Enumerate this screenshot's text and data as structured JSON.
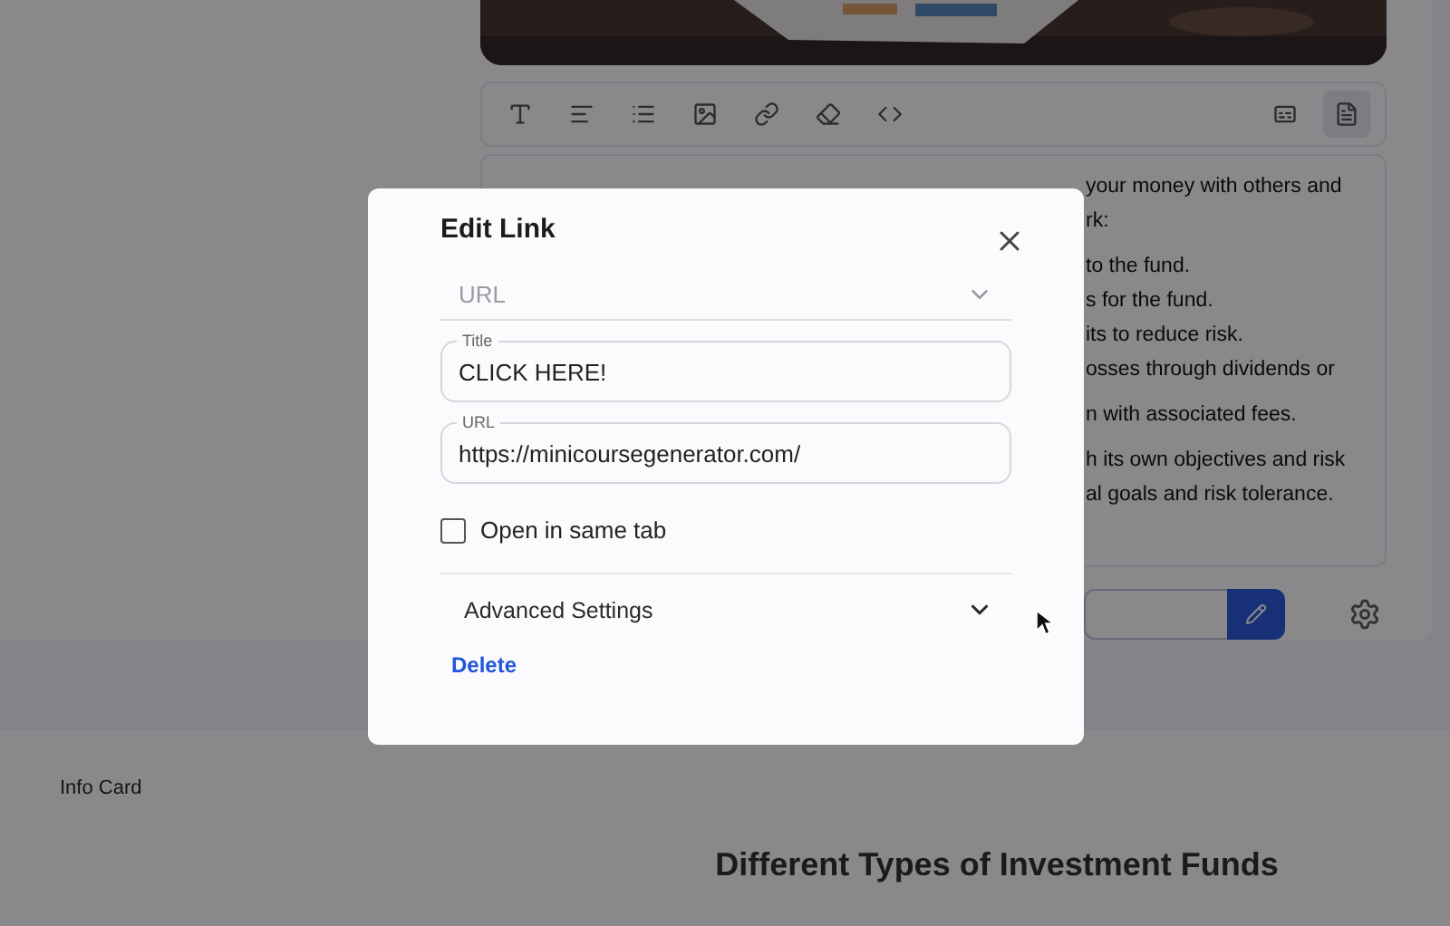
{
  "background": {
    "editor_lines": [
      "your money with others and",
      "rk:",
      "to the fund.",
      "s for the fund.",
      "its to reduce risk.",
      "osses through dividends or",
      "n with associated fees.",
      "h its own objectives and risk",
      "al goals and risk tolerance."
    ],
    "info_card_label": "Info Card",
    "heading": "Different Types of Investment Funds"
  },
  "dialog": {
    "title": "Edit Link",
    "link_type": {
      "value": "URL"
    },
    "fields": [
      {
        "label": "Title",
        "value": "CLICK HERE!"
      },
      {
        "label": "URL",
        "value": "https://minicoursegenerator.com/"
      }
    ],
    "same_tab": {
      "label": "Open in same tab",
      "checked": false
    },
    "advanced": {
      "label": "Advanced Settings",
      "expanded": false
    },
    "delete": "Delete"
  }
}
